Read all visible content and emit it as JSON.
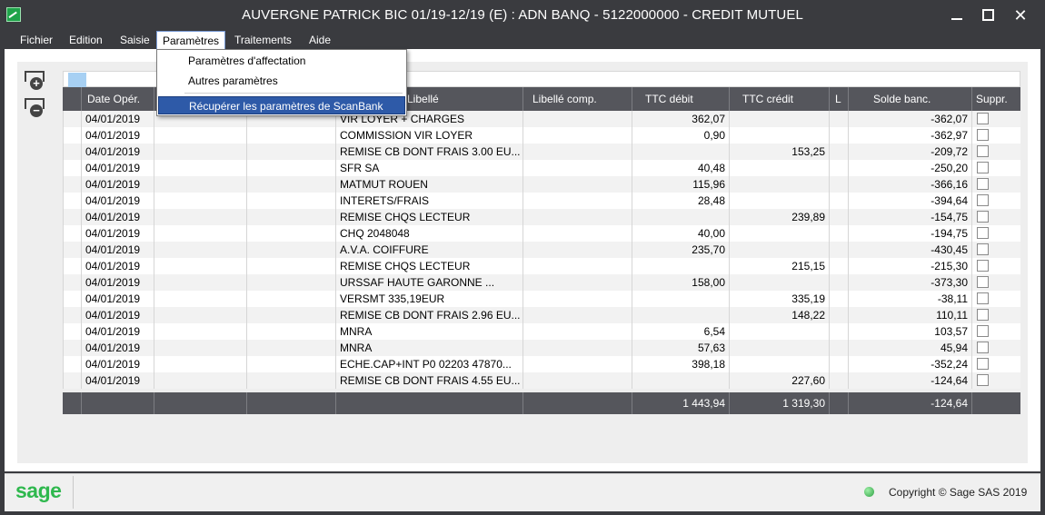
{
  "window": {
    "title": "AUVERGNE PATRICK BIC 01/19-12/19 (E) : ADN BANQ - 5122000000 - CREDIT MUTUEL",
    "minimize_icon": "minimize-icon",
    "maximize_icon": "maximize-icon",
    "close_icon": "close-icon",
    "close_glyph": "✕"
  },
  "menubar": {
    "items": [
      "Fichier",
      "Edition",
      "Saisie",
      "Paramètres",
      "Traitements",
      "Aide"
    ],
    "active": "Paramètres"
  },
  "dropdown": {
    "items": [
      "Paramètres d'affectation",
      "Autres paramètres",
      "Récupérer les paramètres de ScanBank"
    ],
    "selected": "Récupérer les paramètres de ScanBank"
  },
  "side_buttons": {
    "add": "+",
    "remove": "−"
  },
  "table": {
    "headers": [
      "Date Opér.",
      "",
      "",
      "Libellé",
      "Libellé comp.",
      "TTC débit",
      "TTC crédit",
      "L",
      "Solde banc.",
      "Suppr."
    ],
    "rows": [
      [
        "04/01/2019",
        "VIR LOYER + CHARGES",
        "362,07",
        "",
        "-362,07"
      ],
      [
        "04/01/2019",
        "COMMISSION VIR LOYER",
        "0,90",
        "",
        "-362,97"
      ],
      [
        "04/01/2019",
        "REMISE CB DONT FRAIS 3.00 EU...",
        "",
        "153,25",
        "-209,72"
      ],
      [
        "04/01/2019",
        "SFR SA",
        "40,48",
        "",
        "-250,20"
      ],
      [
        "04/01/2019",
        "MATMUT ROUEN",
        "115,96",
        "",
        "-366,16"
      ],
      [
        "04/01/2019",
        "INTERETS/FRAIS",
        "28,48",
        "",
        "-394,64"
      ],
      [
        "04/01/2019",
        "REMISE CHQS LECTEUR",
        "",
        "239,89",
        "-154,75"
      ],
      [
        "04/01/2019",
        "CHQ 2048048",
        "40,00",
        "",
        "-194,75"
      ],
      [
        "04/01/2019",
        "A.V.A. COIFFURE",
        "235,70",
        "",
        "-430,45"
      ],
      [
        "04/01/2019",
        "REMISE CHQS LECTEUR",
        "",
        "215,15",
        "-215,30"
      ],
      [
        "04/01/2019",
        "URSSAF HAUTE GARONNE       ...",
        "158,00",
        "",
        "-373,30"
      ],
      [
        "04/01/2019",
        "VERSMT 335,19EUR",
        "",
        "335,19",
        "-38,11"
      ],
      [
        "04/01/2019",
        "REMISE CB DONT FRAIS 2.96 EU...",
        "",
        "148,22",
        "110,11"
      ],
      [
        "04/01/2019",
        "MNRA",
        "6,54",
        "",
        "103,57"
      ],
      [
        "04/01/2019",
        "MNRA",
        "57,63",
        "",
        "45,94"
      ],
      [
        "04/01/2019",
        "ECHE.CAP+INT P0 02203 47870...",
        "398,18",
        "",
        "-352,24"
      ],
      [
        "04/01/2019",
        "REMISE CB DONT FRAIS 4.55 EU...",
        "",
        "227,60",
        "-124,64"
      ]
    ],
    "totals": {
      "debit": "1 443,94",
      "credit": "1 319,30",
      "solde": "-124,64"
    }
  },
  "statusbar": {
    "logo": "sage",
    "copyright": "Copyright © Sage SAS 2019"
  },
  "colors": {
    "chrome": "#3a3b3f",
    "header": "#55565c",
    "selection": "#2e5aa8",
    "brand": "#2fb84e"
  }
}
